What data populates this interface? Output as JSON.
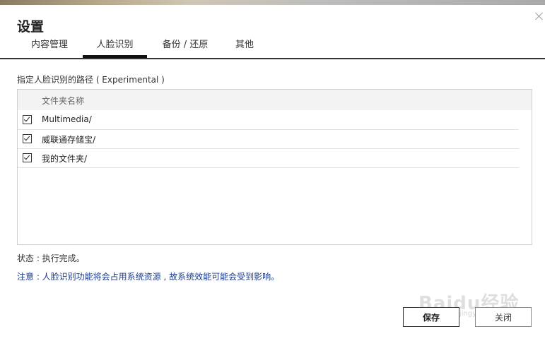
{
  "dialog": {
    "title": "设置",
    "tabs": [
      {
        "label": "内容管理"
      },
      {
        "label": "人脸识别"
      },
      {
        "label": "备份 / 还原"
      },
      {
        "label": "其他"
      }
    ],
    "path_label": "指定人脸识别的路径 ( Experimental )",
    "list": {
      "column_header": "文件夹名称",
      "rows": [
        {
          "label": "Multimedia/",
          "checked": true
        },
        {
          "label": "威联通存储宝/",
          "checked": true
        },
        {
          "label": "我的文件夹/",
          "checked": true
        }
      ]
    },
    "status": "状态 : 执行完成。",
    "notice": "注意 : 人脸识别功能将会占用系统资源 , 故系统效能可能会受到影响。",
    "buttons": {
      "save": "保存",
      "close": "关闭"
    }
  },
  "watermark": {
    "text": "Baidu经验",
    "sub": "jingyan.baidu.com"
  },
  "icons": {
    "close": "close-icon",
    "checkbox": "checkbox-checked-icon"
  }
}
